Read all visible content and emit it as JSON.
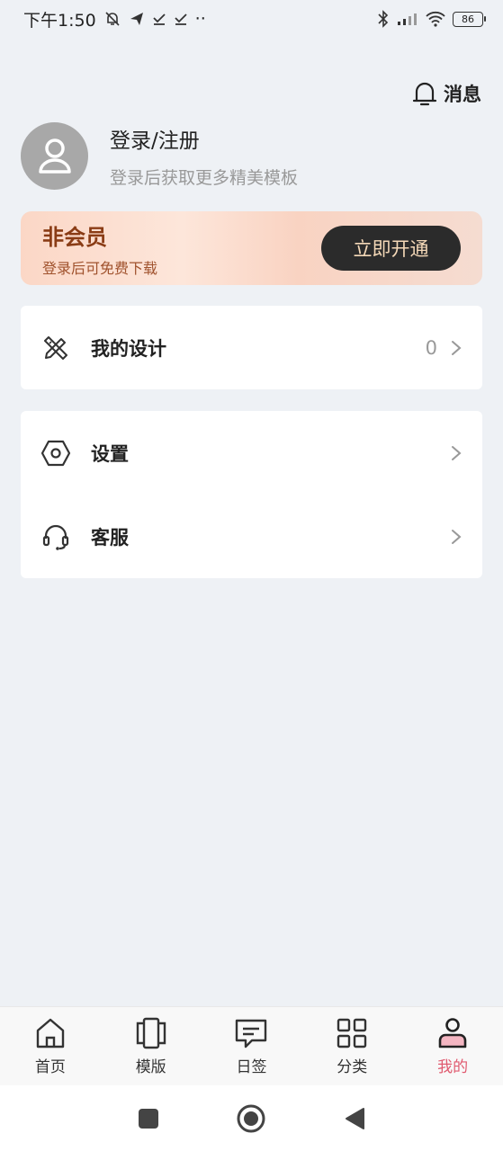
{
  "status": {
    "time": "下午1:50",
    "dots": "··",
    "battery": "86"
  },
  "header": {
    "messages_label": "消息"
  },
  "profile": {
    "login_label": "登录/注册",
    "login_hint": "登录后获取更多精美模板"
  },
  "vip": {
    "title": "非会员",
    "subtitle": "登录后可免费下载",
    "button_label": "立即开通"
  },
  "menu": {
    "design": {
      "label": "我的设计",
      "count": "0"
    },
    "settings": {
      "label": "设置"
    },
    "service": {
      "label": "客服"
    }
  },
  "tabs": [
    {
      "label": "首页",
      "icon": "home-icon"
    },
    {
      "label": "模版",
      "icon": "template-icon"
    },
    {
      "label": "日签",
      "icon": "message-icon"
    },
    {
      "label": "分类",
      "icon": "grid-icon"
    },
    {
      "label": "我的",
      "icon": "user-icon",
      "active": true
    }
  ],
  "colors": {
    "accent": "#e05a6f",
    "vip_text": "#8a3c15",
    "background": "#eef1f5"
  }
}
